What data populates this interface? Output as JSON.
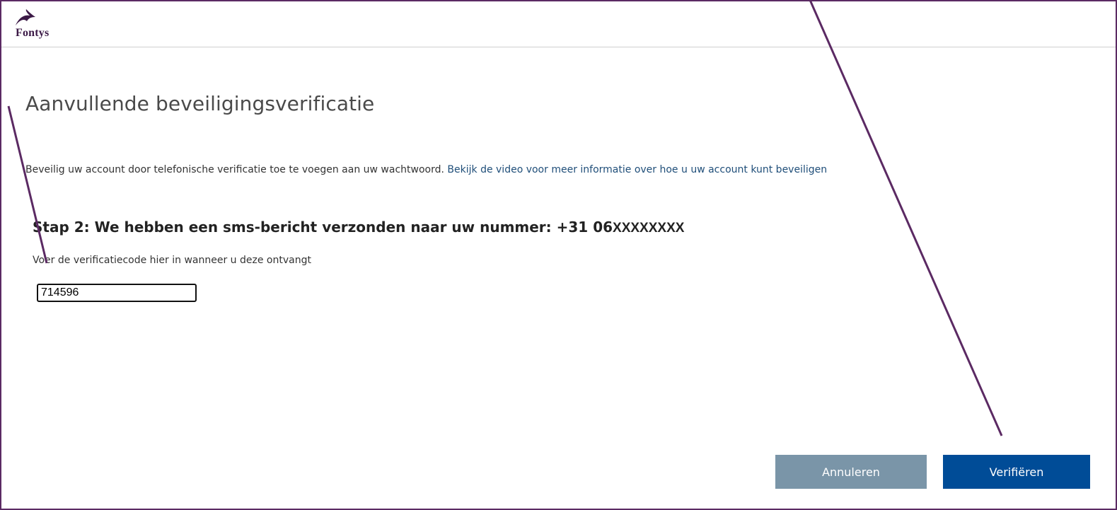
{
  "header": {
    "logo_text": "Fontys",
    "logo_icon": "fontys-dolphin-icon"
  },
  "main": {
    "title": "Aanvullende beveiligingsverificatie",
    "intro_text": "Beveilig uw account door telefonische verificatie toe te voegen aan uw wachtwoord. ",
    "intro_link": "Bekijk de video voor meer informatie over hoe u uw account kunt beveiligen",
    "step_heading": "Stap 2: We hebben een sms-bericht verzonden naar uw nummer: +31 06",
    "step_masked_number": "XXXXXXXX",
    "instruction": "Voer de verificatiecode hier in wanneer u deze ontvangt",
    "code_value": "714596"
  },
  "buttons": {
    "cancel_label": "Annuleren",
    "verify_label": "Verifiëren"
  },
  "colors": {
    "frame": "#5b2a63",
    "link": "#1f4e79",
    "cancel_button": "#7a95a8",
    "verify_button": "#004c97",
    "annotation_arrow": "#5b2a63"
  }
}
